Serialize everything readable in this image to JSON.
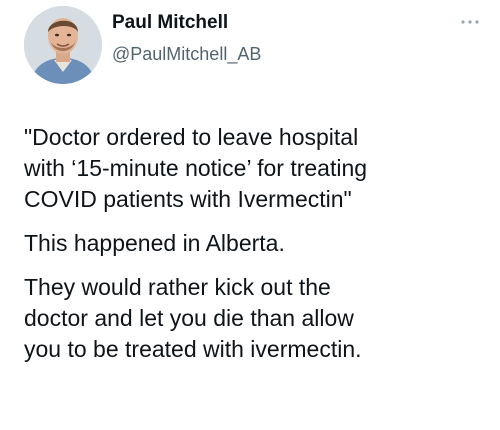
{
  "tweet": {
    "author": {
      "display_name": "Paul Mitchell",
      "handle": "@PaulMitchell_AB",
      "avatar": "profile-photo"
    },
    "more_icon": "ellipsis-icon",
    "paragraphs": [
      {
        "lines": [
          "\"Doctor ordered to leave hospital",
          "with ‘15-minute notice’ for treating",
          "COVID patients with Ivermectin\""
        ]
      },
      {
        "lines": [
          "This happened in Alberta."
        ]
      },
      {
        "lines": [
          "They would rather kick out the",
          "doctor and let you die than allow",
          "you to be treated with ivermectin."
        ]
      }
    ]
  }
}
